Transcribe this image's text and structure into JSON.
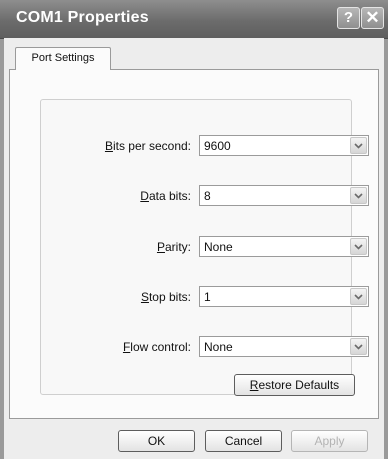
{
  "window": {
    "title": "COM1 Properties",
    "help_glyph": "?",
    "close_glyph": "✕"
  },
  "tabs": [
    {
      "label": "Port Settings",
      "selected": true
    }
  ],
  "settings": [
    {
      "key": "bits_per_second",
      "label_accel": "B",
      "label_rest": "its per second:",
      "value": "9600"
    },
    {
      "key": "data_bits",
      "label_accel": "D",
      "label_rest": "ata bits:",
      "value": "8"
    },
    {
      "key": "parity",
      "label_accel": "P",
      "label_rest": "arity:",
      "value": "None"
    },
    {
      "key": "stop_bits",
      "label_accel": "S",
      "label_rest": "top bits:",
      "value": "1"
    },
    {
      "key": "flow_control",
      "label_accel": "F",
      "label_rest": "low control:",
      "value": "None"
    }
  ],
  "buttons": {
    "restore_accel": "R",
    "restore_rest": "estore Defaults",
    "ok": "OK",
    "cancel": "Cancel",
    "apply": "Apply"
  },
  "icons": {
    "help": "help-icon",
    "close": "close-icon",
    "dropdown": "chevron-down-icon"
  }
}
